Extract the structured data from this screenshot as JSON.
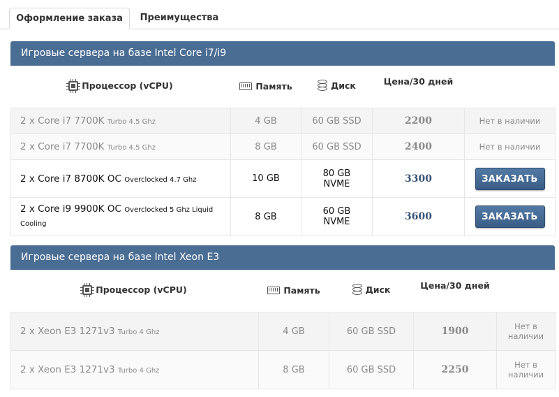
{
  "tabs": [
    {
      "label": "Оформление заказа",
      "active": true
    },
    {
      "label": "Преимущества",
      "active": false
    }
  ],
  "columns": {
    "cpu": "Процессор (vCPU)",
    "memory": "Память",
    "disk": "Диск",
    "price": "Цена/30 дней"
  },
  "icons": {
    "cpu": "cpu-chip-icon",
    "memory": "memory-module-icon",
    "disk": "database-disk-icon"
  },
  "colors": {
    "section_header": "#4a6d94",
    "order_button": "#3f6390",
    "price": "#4d6480"
  },
  "sections": [
    {
      "title": "Игровые сервера на базе Intel Core i7/i9",
      "rows": [
        {
          "cpu": "2 x Core i7 7700K",
          "turbo": "Turbo 4.5 Ghz",
          "memory": "4 GB",
          "disk": "60 GB SSD",
          "price": "2200",
          "status": "Нет в наличии"
        },
        {
          "cpu": "2 x Core i7 7700K",
          "turbo": "Turbo 4.5 Ghz",
          "memory": "8 GB",
          "disk": "60 GB SSD",
          "price": "2400",
          "status": "Нет в наличии"
        },
        {
          "cpu": "2 x Core i7 8700K OC",
          "turbo": "Overclocked 4.7 Ghz",
          "memory": "10 GB",
          "disk_line1": "80 GB",
          "disk_line2": "NVME",
          "price": "3300",
          "button": "ЗАКАЗАТЬ"
        },
        {
          "cpu": "2 x Core i9 9900K OC",
          "turbo": "Overclocked 5 Ghz Liquid Cooling",
          "memory": "8 GB",
          "disk_line1": "60 GB",
          "disk_line2": "NVME",
          "price": "3600",
          "button": "ЗАКАЗАТЬ"
        }
      ]
    },
    {
      "title": "Игровые сервера на базе Intel Xeon E3",
      "rows": [
        {
          "cpu": "2 x Xeon E3 1271v3",
          "turbo": "Turbo 4 Ghz",
          "memory": "4 GB",
          "disk": "60 GB SSD",
          "price": "1900",
          "status_line1": "Нет в",
          "status_line2": "наличии"
        },
        {
          "cpu": "2 x Xeon E3 1271v3",
          "turbo": "Turbo 4 Ghz",
          "memory": "8 GB",
          "disk": "60 GB SSD",
          "price": "2250",
          "status_line1": "Нет в",
          "status_line2": "наличии"
        }
      ]
    }
  ]
}
